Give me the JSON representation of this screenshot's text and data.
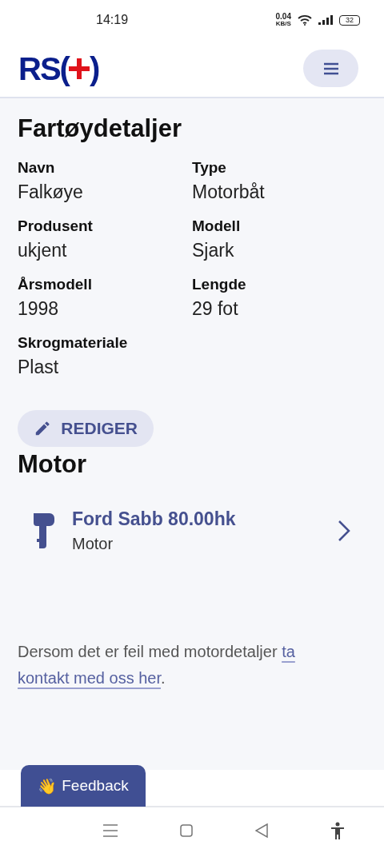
{
  "status_bar": {
    "time": "14:19",
    "speed": "0.04",
    "speed_unit": "KB/S",
    "battery": "32"
  },
  "header": {
    "logo": {
      "letters": "RS",
      "open": "(",
      "close": ")"
    }
  },
  "title": "Fartøydetaljer",
  "fields": [
    {
      "label": "Navn",
      "value": "Falkøye"
    },
    {
      "label": "Type",
      "value": "Motorbåt"
    },
    {
      "label": "Produsent",
      "value": "ukjent"
    },
    {
      "label": "Modell",
      "value": "Sjark"
    },
    {
      "label": "Årsmodell",
      "value": "1998"
    },
    {
      "label": "Lengde",
      "value": "29 fot"
    },
    {
      "label": "Skrogmateriale",
      "value": "Plast"
    }
  ],
  "edit_button": "REDIGER",
  "motor": {
    "heading": "Motor",
    "items": [
      {
        "name": "Ford Sabb 80.00hk",
        "subtitle": "Motor"
      }
    ]
  },
  "note": {
    "text": "Dersom det er feil med motordetaljer ",
    "link": [
      "ta",
      "kontakt med oss her"
    ],
    "end": "."
  },
  "feedback": {
    "emoji": "👋",
    "label": "Feedback"
  }
}
